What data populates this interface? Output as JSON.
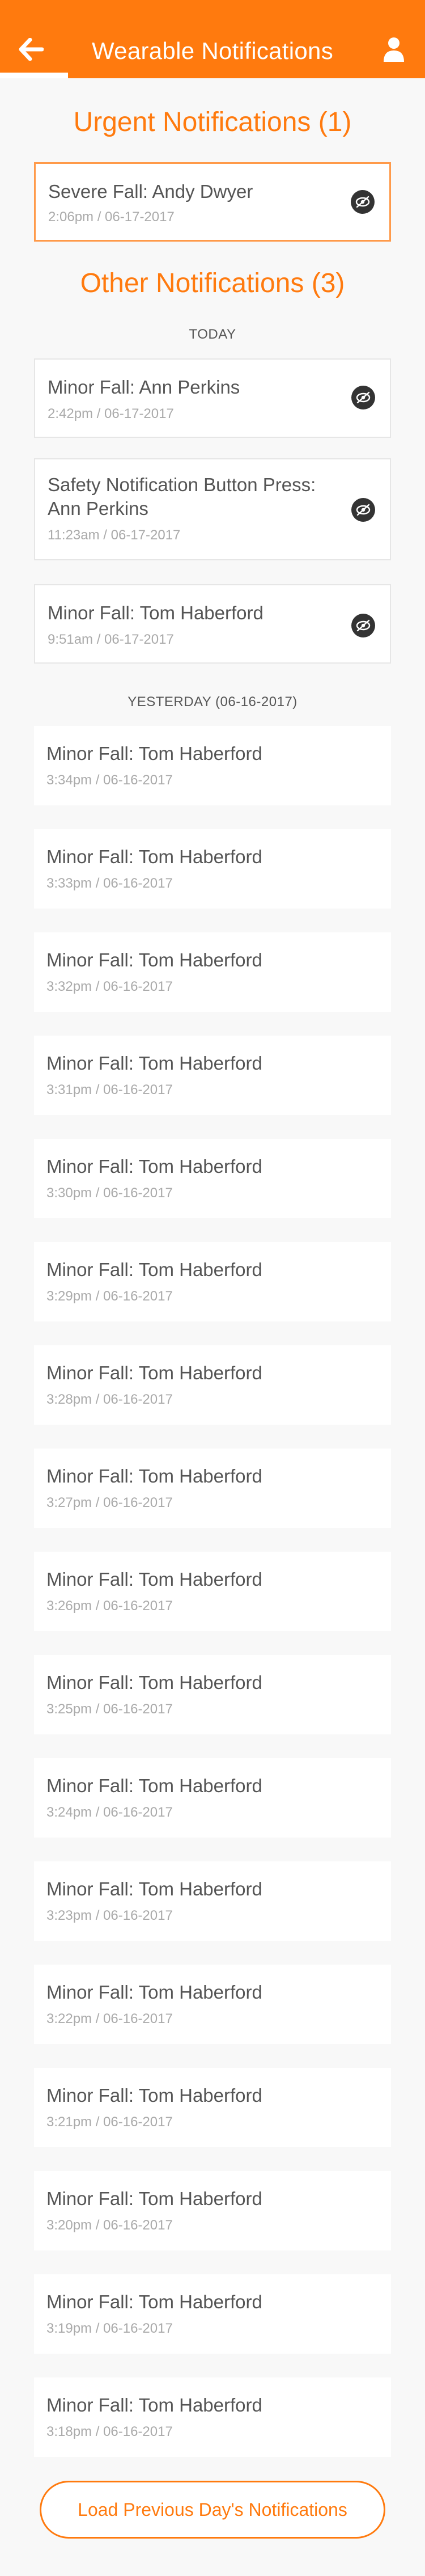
{
  "header": {
    "title": "Wearable Notifications",
    "back_icon": "arrow-left-icon",
    "user_icon": "user-icon",
    "color": "#ff7a0e"
  },
  "urgent": {
    "title": "Urgent Notifications (1)",
    "items": [
      {
        "title": "Severe Fall: Andy Dwyer",
        "time": "2:06pm / 06-17-2017"
      }
    ]
  },
  "other": {
    "title": "Other Notifications (3)",
    "today_label": "TODAY",
    "today_items": [
      {
        "title": "Minor Fall: Ann Perkins",
        "time": "2:42pm / 06-17-2017"
      },
      {
        "title": "Safety Notification Button Press: Ann Perkins",
        "time": "11:23am / 06-17-2017"
      },
      {
        "title": "Minor Fall: Tom Haberford",
        "time": "9:51am / 06-17-2017"
      }
    ],
    "yesterday_label": "YESTERDAY (06-16-2017)",
    "yesterday_items": [
      {
        "title": "Minor Fall: Tom Haberford",
        "time": "3:34pm / 06-16-2017"
      },
      {
        "title": "Minor Fall: Tom Haberford",
        "time": "3:33pm / 06-16-2017"
      },
      {
        "title": "Minor Fall: Tom Haberford",
        "time": "3:32pm / 06-16-2017"
      },
      {
        "title": "Minor Fall: Tom Haberford",
        "time": "3:31pm / 06-16-2017"
      },
      {
        "title": "Minor Fall: Tom Haberford",
        "time": "3:30pm / 06-16-2017"
      },
      {
        "title": "Minor Fall: Tom Haberford",
        "time": "3:29pm / 06-16-2017"
      },
      {
        "title": "Minor Fall: Tom Haberford",
        "time": "3:28pm / 06-16-2017"
      },
      {
        "title": "Minor Fall: Tom Haberford",
        "time": "3:27pm / 06-16-2017"
      },
      {
        "title": "Minor Fall: Tom Haberford",
        "time": "3:26pm / 06-16-2017"
      },
      {
        "title": "Minor Fall: Tom Haberford",
        "time": "3:25pm / 06-16-2017"
      },
      {
        "title": "Minor Fall: Tom Haberford",
        "time": "3:24pm / 06-16-2017"
      },
      {
        "title": "Minor Fall: Tom Haberford",
        "time": "3:23pm / 06-16-2017"
      },
      {
        "title": "Minor Fall: Tom Haberford",
        "time": "3:22pm / 06-16-2017"
      },
      {
        "title": "Minor Fall: Tom Haberford",
        "time": "3:21pm / 06-16-2017"
      },
      {
        "title": "Minor Fall: Tom Haberford",
        "time": "3:20pm / 06-16-2017"
      },
      {
        "title": "Minor Fall: Tom Haberford",
        "time": "3:19pm / 06-16-2017"
      },
      {
        "title": "Minor Fall: Tom Haberford",
        "time": "3:18pm / 06-16-2017"
      }
    ]
  },
  "load_button": {
    "label": "Load Previous Day's Notifications"
  },
  "eye_icon": "eye-slash-icon"
}
